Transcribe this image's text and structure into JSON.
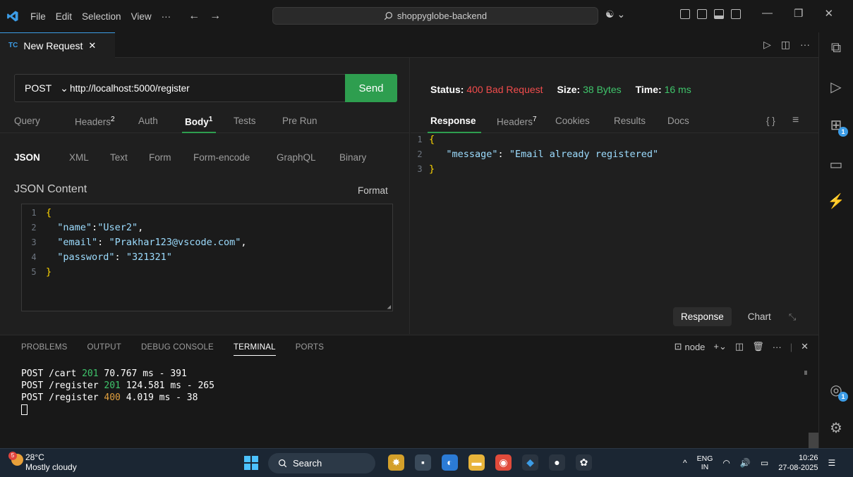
{
  "titlebar": {
    "menu": [
      "File",
      "Edit",
      "Selection",
      "View",
      "···"
    ],
    "search_text": "shoppyglobe-backend"
  },
  "tab": {
    "badge": "TC",
    "label": "New Request",
    "close": "✕"
  },
  "request": {
    "method": "POST",
    "url": "http://localhost:5000/register",
    "send_label": "Send",
    "tabs": {
      "query": "Query",
      "headers": "Headers",
      "headers_count": "2",
      "auth": "Auth",
      "body": "Body",
      "body_count": "1",
      "tests": "Tests",
      "prerun": "Pre Run"
    },
    "body_tabs": {
      "json": "JSON",
      "xml": "XML",
      "text": "Text",
      "form": "Form",
      "form_encode": "Form-encode",
      "graphql": "GraphQL",
      "binary": "Binary"
    },
    "content_title": "JSON Content",
    "format_label": "Format",
    "code": {
      "ln1": "1",
      "ln2": "2",
      "ln3": "3",
      "ln4": "4",
      "ln5": "5",
      "open": "{",
      "k_name": "\"name\"",
      "v_name": "\"User2\"",
      "k_email": "\"email\"",
      "v_email": "\"Prakhar123@vscode.com\"",
      "k_password": "\"password\"",
      "v_password": "\"321321\"",
      "close": "}"
    }
  },
  "response": {
    "status_label": "Status:",
    "status_value": "400 Bad Request",
    "size_label": "Size:",
    "size_value": "38 Bytes",
    "time_label": "Time:",
    "time_value": "16 ms",
    "tabs": {
      "response": "Response",
      "headers": "Headers",
      "headers_count": "7",
      "cookies": "Cookies",
      "results": "Results",
      "docs": "Docs"
    },
    "code": {
      "ln1": "1",
      "ln2": "2",
      "ln3": "3",
      "open": "{",
      "key": "\"message\"",
      "value": "\"Email already registered\"",
      "close": "}"
    },
    "view_response": "Response",
    "view_chart": "Chart"
  },
  "panel": {
    "tabs": [
      "PROBLEMS",
      "OUTPUT",
      "DEBUG CONSOLE",
      "TERMINAL",
      "PORTS"
    ],
    "terminal_name": "node",
    "lines": [
      {
        "pre": "POST /cart ",
        "code": "201",
        "post": " 70.767 ms - 391"
      },
      {
        "pre": "POST /register ",
        "code": "201",
        "post": " 124.581 ms - 265"
      },
      {
        "pre": "POST /register ",
        "code": "400",
        "post": " 4.019 ms - 38"
      }
    ]
  },
  "taskbar": {
    "weather_badge": "5",
    "temperature": "28°C",
    "condition": "Mostly cloudy",
    "search_label": "Search",
    "lang_top": "ENG",
    "lang_bottom": "IN",
    "time": "10:26",
    "date": "27-08-2025"
  },
  "colors": {
    "accent": "#3c9ce6",
    "send": "#2e9e4f",
    "status_error": "#f14c4c",
    "ok": "#3fc56b"
  }
}
